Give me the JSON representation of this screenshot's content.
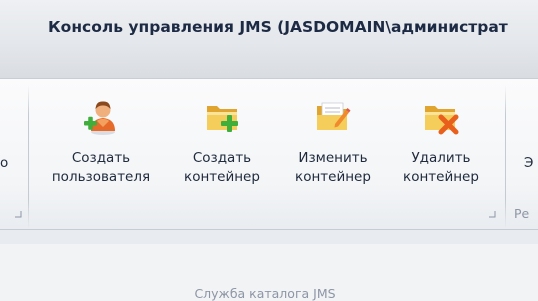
{
  "window": {
    "title": "Консоль управления JMS (JASDOMAIN\\администрат"
  },
  "ribbon": {
    "left_fragment": "о",
    "right_fragment_top": "Э",
    "right_fragment_bottom": "Ре",
    "group": {
      "label": "Служба каталога JMS",
      "buttons": [
        {
          "line1": "Создать",
          "line2": "пользователя",
          "icon": "add-user-icon"
        },
        {
          "line1": "Создать",
          "line2": "контейнер",
          "icon": "add-container-icon"
        },
        {
          "line1": "Изменить",
          "line2": "контейнер",
          "icon": "edit-container-icon"
        },
        {
          "line1": "Удалить",
          "line2": "контейнер",
          "icon": "delete-container-icon"
        }
      ]
    }
  },
  "colors": {
    "title": "#1d2a44",
    "add_green": "#3fae3a",
    "delete_orange": "#e8601c",
    "folder_yellow": "#f2c24a"
  }
}
